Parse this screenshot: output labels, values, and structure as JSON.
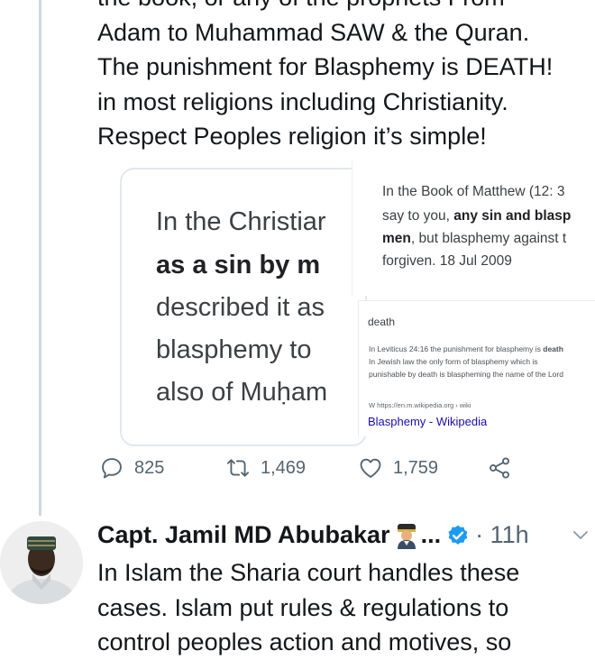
{
  "tweet": {
    "lines": [
      "the book, or any of the prophets From",
      "Adam to Muhammad SAW & the Quran.",
      "The punishment for Blasphemy is DEATH!",
      "in most religions including Christianity.",
      "Respect Peoples religion it’s simple!"
    ]
  },
  "image_left": {
    "lines": [
      "In the Christiar",
      "as a sin by m",
      "described it as",
      "blasphemy to ",
      "also of Muḥam"
    ]
  },
  "image_right_top": {
    "line1": "In the Book of Matthew (12: 3",
    "line2_pre": "say to you, ",
    "line2_bold": "any sin and blasp",
    "line3_bold": "men",
    "line3_post": ", but blasphemy against t",
    "line4": "forgiven. 18 Jul 2009"
  },
  "image_right_bottom": {
    "word": "death",
    "line1_pre": "In Leviticus 24:16 the punishment for blasphemy is ",
    "line1_bold": "death",
    "line2": "In Jewish law the only form of blasphemy which is",
    "line3": "punishable by death is blaspheming the name of the Lord",
    "source": "W  https://en.m.wikipedia.org › wiki",
    "link": "Blasphemy - Wikipedia"
  },
  "actions": {
    "replies": "825",
    "retweets": "1,469",
    "likes": "1,759"
  },
  "reply": {
    "name": "Capt. Jamil MD Abubakar",
    "ellipsis": "...",
    "time": "· 11h",
    "lines": [
      "In Islam the Sharia court handles these",
      "cases. Islam put rules & regulations to",
      "control peoples action and motives, so"
    ]
  },
  "colors": {
    "text": "#14171a",
    "secondary": "#536471",
    "verified": "#1d9bf0",
    "link": "#1a0dab"
  }
}
